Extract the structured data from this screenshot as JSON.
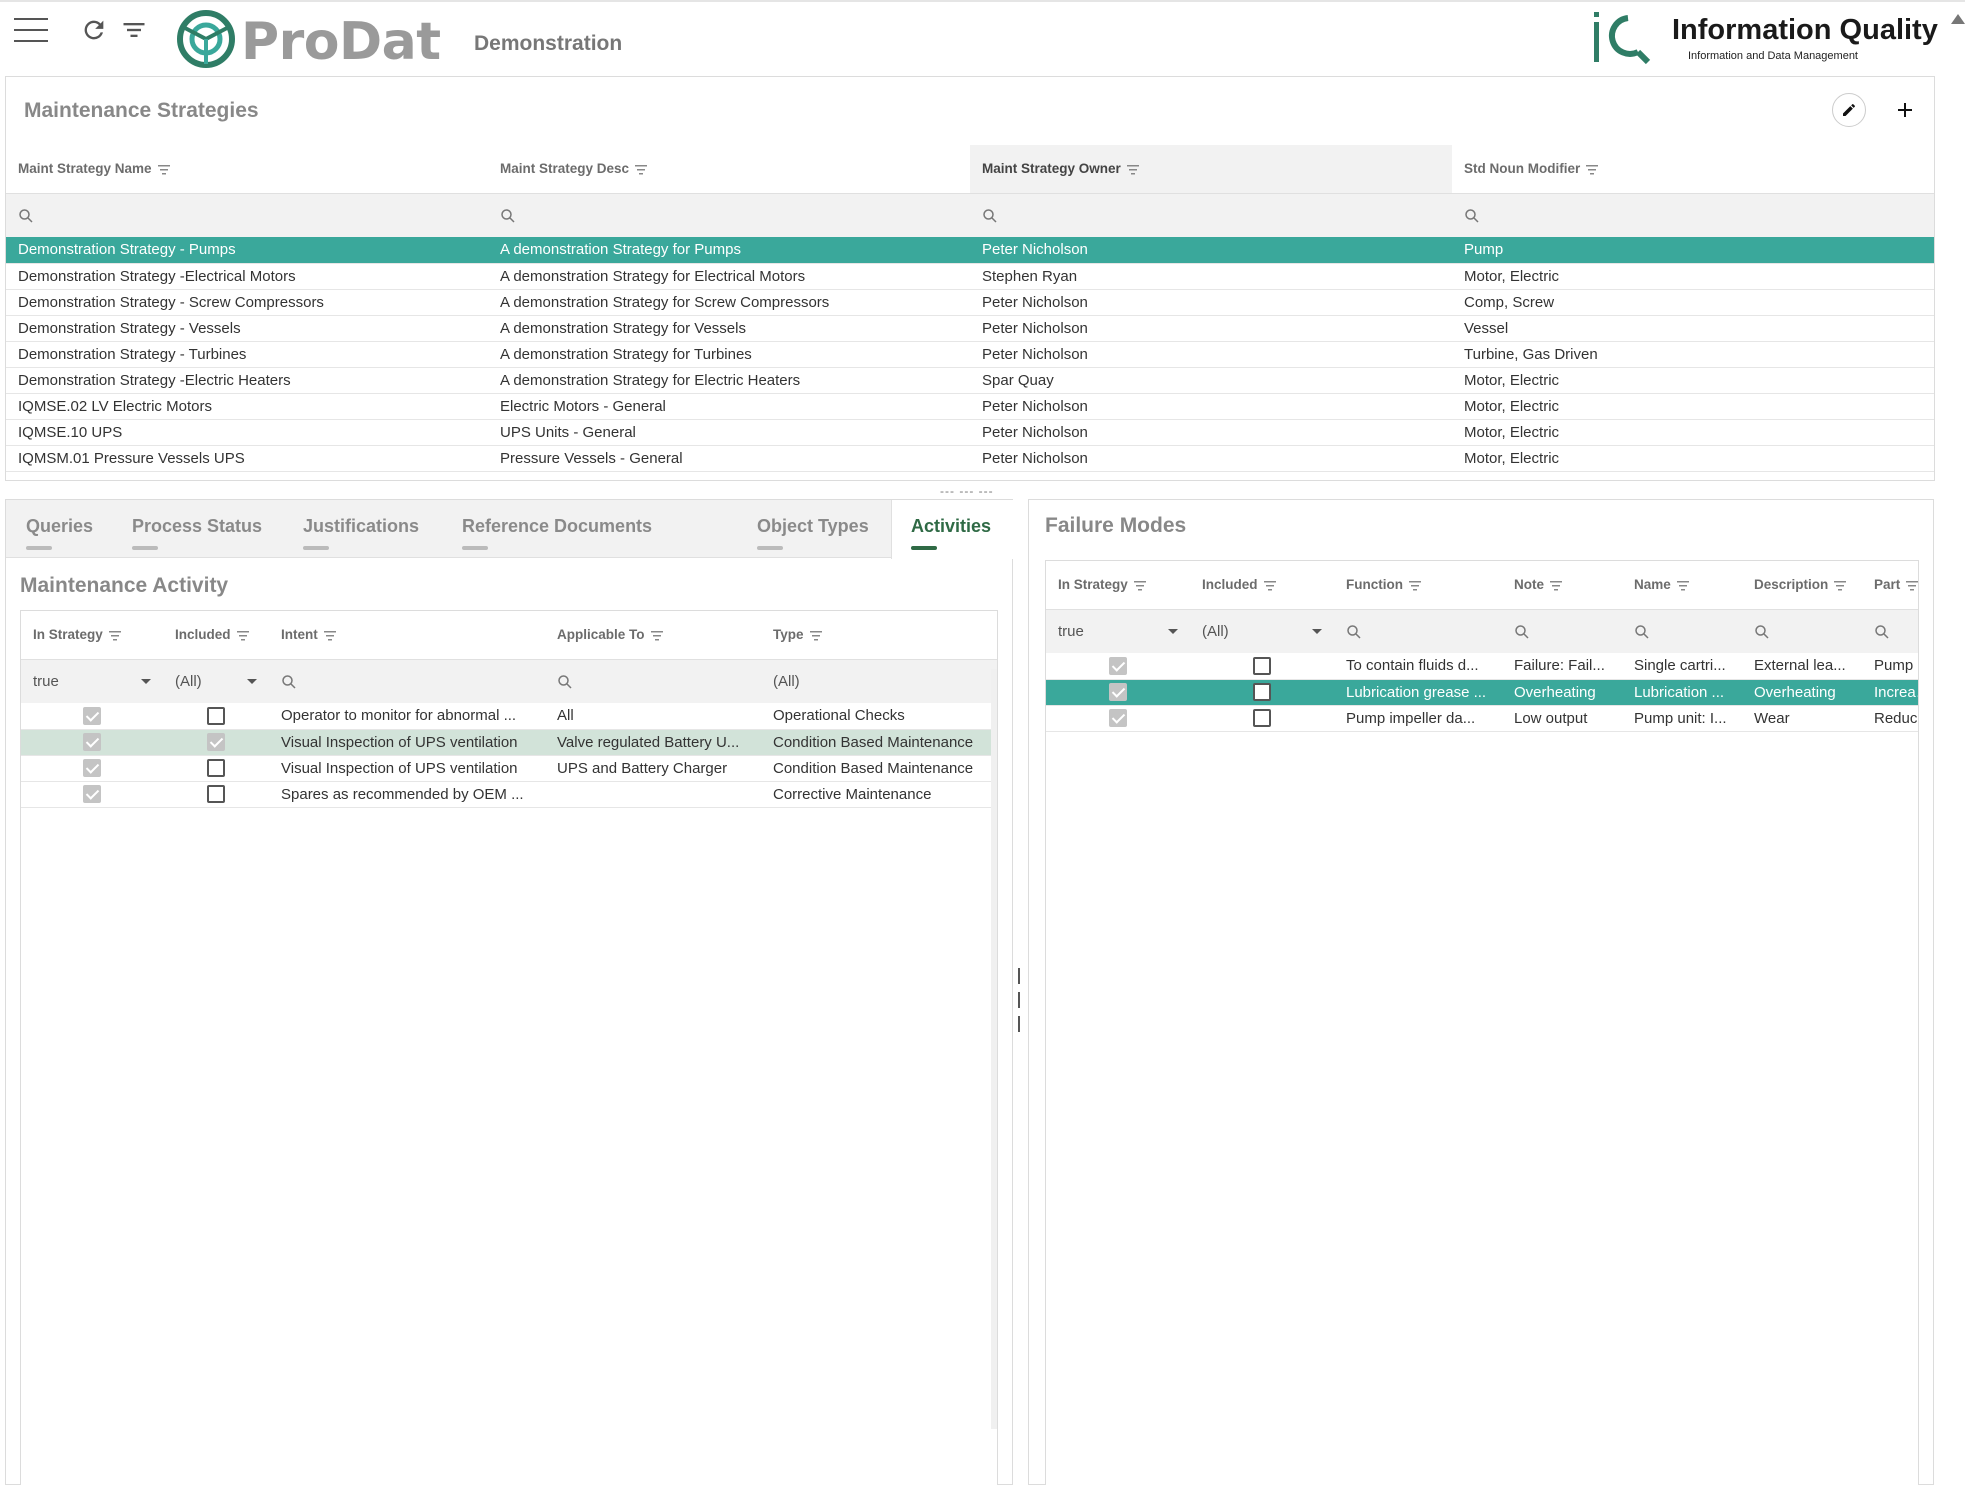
{
  "header": {
    "app_name": "ProDat",
    "environment": "Demonstration",
    "company_name": "Information Quality",
    "company_tagline": "Information and Data Management",
    "accent_color": "#3aa89b",
    "icons": [
      "hamburger-menu-icon",
      "refresh-icon",
      "filter-icon",
      "prodat-logo-icon",
      "iq-logo-icon",
      "scroll-up-icon"
    ]
  },
  "strategies": {
    "title": "Maintenance Strategies",
    "columns": [
      "Maint Strategy Name",
      "Maint Strategy Desc",
      "Maint Strategy Owner",
      "Std Noun Modifier"
    ],
    "rows": [
      [
        "Demonstration Strategy - Pumps",
        "A demonstration Strategy for Pumps",
        "Peter Nicholson",
        "Pump"
      ],
      [
        "Demonstration Strategy -Electrical Motors",
        "A demonstration Strategy for Electrical Motors",
        "Stephen Ryan",
        "Motor, Electric"
      ],
      [
        "Demonstration Strategy - Screw Compressors",
        "A demonstration Strategy for Screw Compressors",
        "Peter Nicholson",
        "Comp, Screw"
      ],
      [
        "Demonstration Strategy - Vessels",
        "A demonstration Strategy for Vessels",
        "Peter Nicholson",
        "Vessel"
      ],
      [
        "Demonstration Strategy - Turbines",
        "A demonstration Strategy for Turbines",
        "Peter Nicholson",
        "Turbine, Gas Driven"
      ],
      [
        "Demonstration Strategy -Electric Heaters",
        "A demonstration Strategy for Electric Heaters",
        "Spar Quay",
        "Motor, Electric"
      ],
      [
        "IQMSE.02 LV Electric Motors",
        "Electric Motors - General",
        "Peter Nicholson",
        "Motor, Electric"
      ],
      [
        "IQMSE.10 UPS",
        "UPS Units - General",
        "Peter Nicholson",
        "Motor, Electric"
      ],
      [
        "IQMSM.01 Pressure Vessels UPS",
        "Pressure Vessels - General",
        "Peter Nicholson",
        "Motor, Electric"
      ]
    ]
  },
  "tabs": [
    "Queries",
    "Process Status",
    "Justifications",
    "Reference Documents",
    "Object Types",
    "Activities"
  ],
  "activity": {
    "title": "Maintenance Activity",
    "columns": [
      "In Strategy",
      "Included",
      "Intent",
      "Applicable To",
      "Type"
    ],
    "filters": {
      "in_strategy": "true",
      "included": "(All)",
      "type": "(All)"
    },
    "rows": [
      {
        "in_strategy": true,
        "included": false,
        "intent": "Operator to monitor for abnormal ...",
        "applicable": "All",
        "type": "Operational Checks"
      },
      {
        "in_strategy": true,
        "included": true,
        "intent": "Visual Inspection of UPS ventilation",
        "applicable": "Valve regulated Battery U...",
        "type": "Condition Based Maintenance"
      },
      {
        "in_strategy": true,
        "included": false,
        "intent": "Visual Inspection of UPS ventilation",
        "applicable": "UPS and Battery Charger",
        "type": "Condition Based Maintenance"
      },
      {
        "in_strategy": true,
        "included": false,
        "intent": "Spares as recommended by OEM ...",
        "applicable": "",
        "type": "Corrective Maintenance"
      }
    ]
  },
  "failure": {
    "title": "Failure Modes",
    "columns": [
      "In Strategy",
      "Included",
      "Function",
      "Note",
      "Name",
      "Description",
      "Part"
    ],
    "filters": {
      "in_strategy": "true",
      "included": "(All)"
    },
    "rows": [
      {
        "in_strategy": true,
        "included": false,
        "function": "To contain fluids d...",
        "note": "Failure: Fail...",
        "name": "Single cartri...",
        "description": "External lea...",
        "part": "Pump unit"
      },
      {
        "in_strategy": true,
        "included": false,
        "function": "Lubrication grease ...",
        "note": "Overheating",
        "name": "Lubrication ...",
        "description": "Overheating",
        "part": "Increased"
      },
      {
        "in_strategy": true,
        "included": false,
        "function": "Pump impeller da...",
        "note": "Low output",
        "name": "Pump unit: I...",
        "description": "Wear",
        "part": "Reduced"
      }
    ]
  }
}
